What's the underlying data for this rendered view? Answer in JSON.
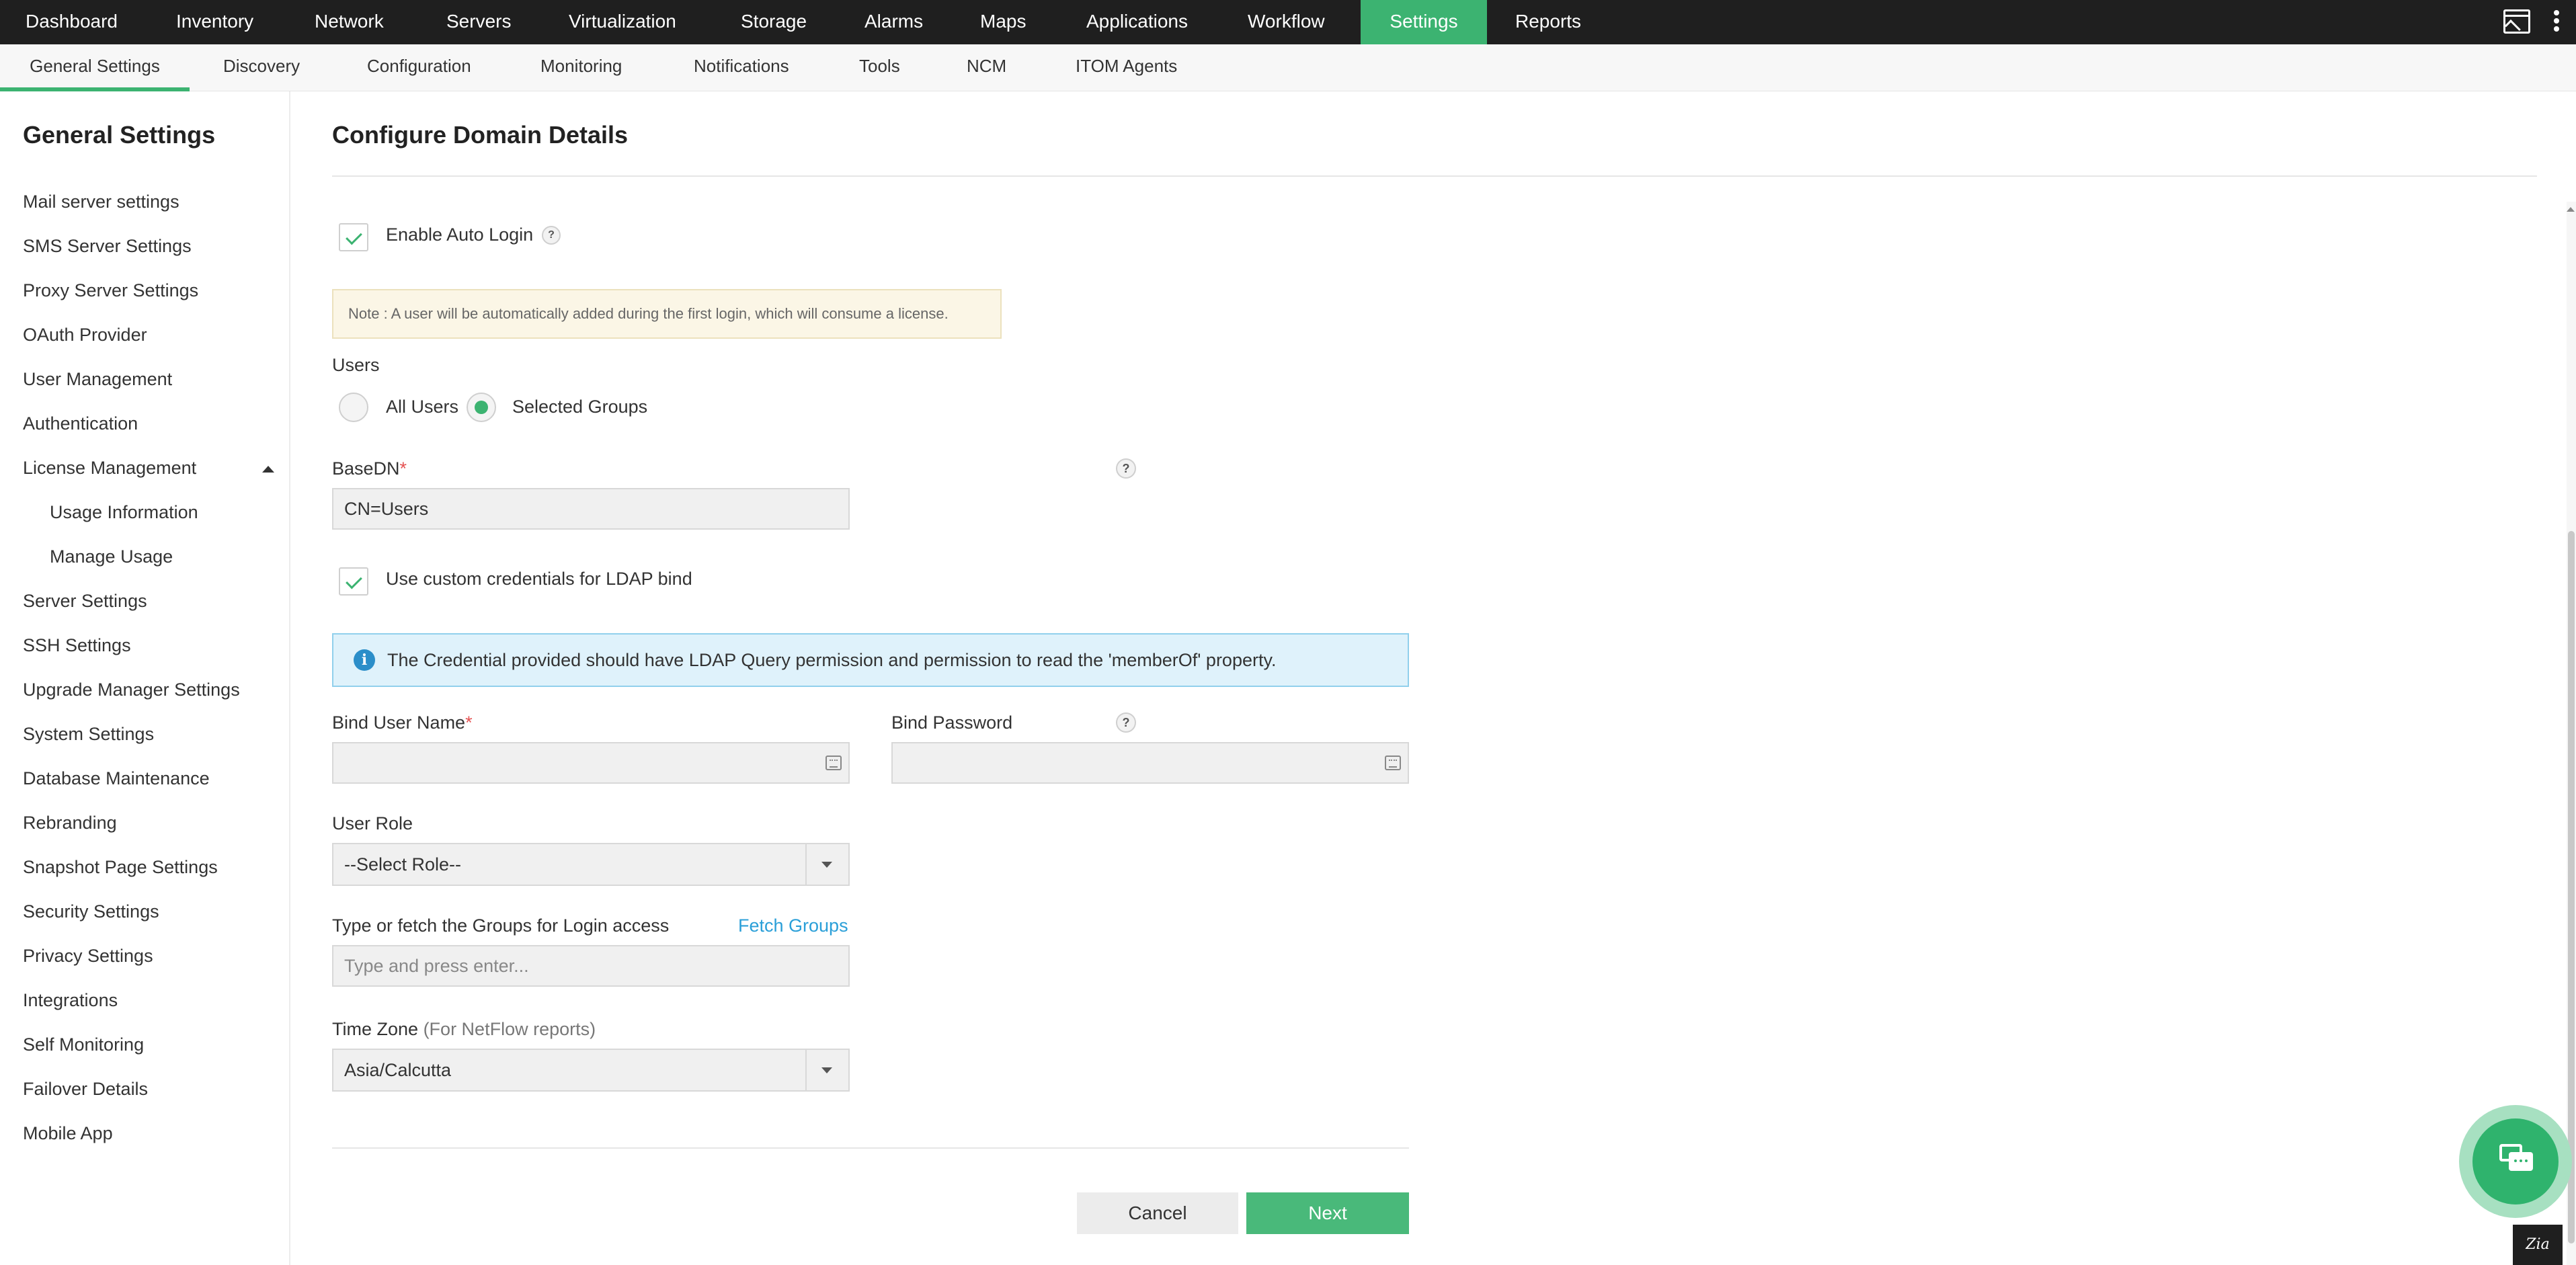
{
  "top_nav": {
    "items": [
      "Dashboard",
      "Inventory",
      "Network",
      "Servers",
      "Virtualization",
      "Storage",
      "Alarms",
      "Maps",
      "Applications",
      "Workflow",
      "Settings",
      "Reports"
    ],
    "active": "Settings"
  },
  "sub_nav": {
    "items": [
      "General Settings",
      "Discovery",
      "Configuration",
      "Monitoring",
      "Notifications",
      "Tools",
      "NCM",
      "ITOM Agents"
    ],
    "active": "General Settings"
  },
  "sidebar": {
    "title": "General Settings",
    "items": [
      "Mail server settings",
      "SMS Server Settings",
      "Proxy Server Settings",
      "OAuth Provider",
      "User Management",
      "Authentication",
      "License Management",
      "Usage Information",
      "Manage Usage",
      "Server Settings",
      "SSH Settings",
      "Upgrade Manager Settings",
      "System Settings",
      "Database Maintenance",
      "Rebranding",
      "Snapshot Page Settings",
      "Security Settings",
      "Privacy Settings",
      "Integrations",
      "Self Monitoring",
      "Failover Details",
      "Mobile App"
    ]
  },
  "form": {
    "title": "Configure Domain Details",
    "auto_login_label": "Enable Auto Login",
    "auto_login_checked": true,
    "help_glyph": "?",
    "note": "Note : A user will be automatically added during the first login, which will consume a license.",
    "users_label": "Users",
    "users_all": "All Users",
    "users_selected": "Selected Groups",
    "users_value": "Selected Groups",
    "basedn_label": "BaseDN",
    "required_mark": "*",
    "basedn_value": "CN=Users",
    "custom_creds_label": "Use custom credentials for LDAP bind",
    "custom_creds_checked": true,
    "info_text": "The Credential provided should have LDAP Query permission and permission to read the 'memberOf' property.",
    "info_glyph": "i",
    "bind_user_label": "Bind User Name",
    "bind_user_value": "",
    "bind_password_label": "Bind Password",
    "bind_password_value": "",
    "user_role_label": "User Role",
    "user_role_value": "--Select Role--",
    "groups_label": "Type or fetch the Groups for Login access",
    "fetch_groups": "Fetch Groups",
    "groups_placeholder": "Type and press enter...",
    "timezone_label": "Time Zone",
    "timezone_hint": "(For NetFlow reports)",
    "timezone_value": "Asia/Calcutta",
    "cancel_label": "Cancel",
    "next_label": "Next"
  },
  "corner_badge": "Zia",
  "colors": {
    "accent": "#3cb371",
    "topbar": "#1f1f1f",
    "link": "#2a9fd8",
    "info_bg": "#dff2fb",
    "note_bg": "#fbf6e6"
  }
}
